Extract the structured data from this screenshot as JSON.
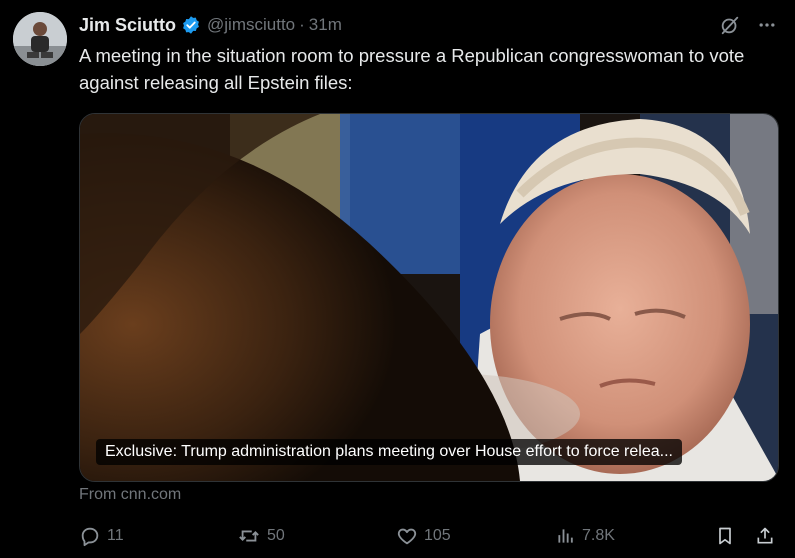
{
  "post": {
    "author_name": "Jim Sciutto",
    "handle": "@jimsciutto",
    "separator": "·",
    "time": "31m",
    "text": "A meeting in the situation room to pressure a Republican congresswoman to vote against releasing all Epstein files:"
  },
  "card": {
    "caption": "Exclusive: Trump administration plans meeting over House effort to force relea...",
    "source": "From cnn.com"
  },
  "actions": {
    "replies": "11",
    "reposts": "50",
    "likes": "105",
    "views": "7.8K"
  },
  "icons": {
    "verified": "verified-badge-icon",
    "grok": "grok-icon",
    "more": "more-icon",
    "reply": "reply-icon",
    "repost": "repost-icon",
    "like": "heart-icon",
    "views": "views-icon",
    "bookmark": "bookmark-icon",
    "share": "share-icon"
  },
  "colors": {
    "background": "#000000",
    "text": "#e7e9ea",
    "muted": "#71767b",
    "verified": "#1d9bf0"
  }
}
